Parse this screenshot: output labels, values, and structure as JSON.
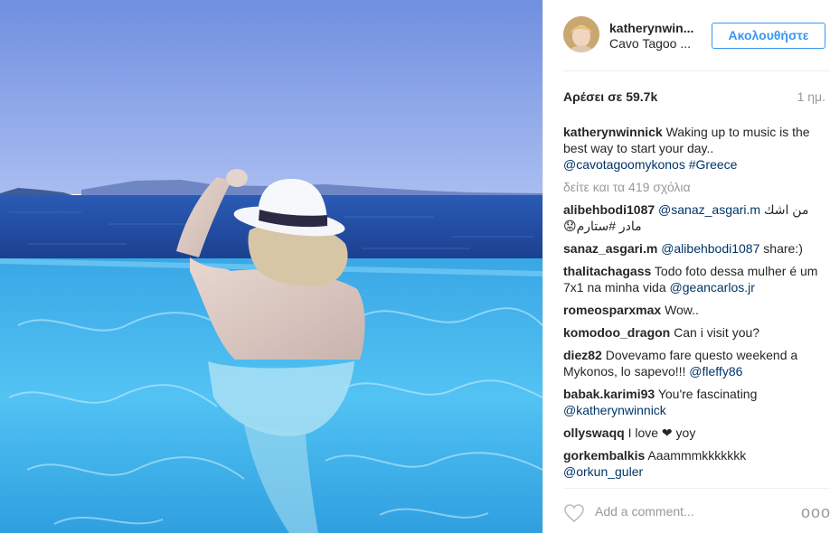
{
  "post": {
    "username": "katherynwin...",
    "location": "Cavo Tagoo ...",
    "follow_label": "Ακολουθήστε",
    "likes": "Αρέσει σε 59.7k",
    "time": "1 ημ.",
    "caption": {
      "user": "katherynwinnick",
      "text": "Waking up to music is the best way to start your day.. ",
      "mention": "@cavotagoomykonos",
      "hashtag": "#Greece"
    },
    "view_all": "δείτε και τα 419 σχόλια",
    "comments": [
      {
        "user": "alibehbodi1087",
        "mention": "@sanaz_asgari.m",
        "text": "من اشك مادر #ستارم😟"
      },
      {
        "user": "sanaz_asgari.m",
        "mention": "@alibehbodi1087",
        "text": " share:)"
      },
      {
        "user": "thalitachagass",
        "text": "Todo foto dessa mulher é um 7x1 na minha vida ",
        "mention": "@geancarlos.jr"
      },
      {
        "user": "romeosparxmax",
        "text": "Wow.."
      },
      {
        "user": "komodoo_dragon",
        "text": "Can i visit you?"
      },
      {
        "user": "diez82",
        "text": "Dovevamo fare questo weekend a Mykonos, lo sapevo!!! ",
        "mention": "@fleffy86"
      },
      {
        "user": "babak.karimi93",
        "text": "You're fascinating ",
        "mention": "@katherynwinnick"
      },
      {
        "user": "ollyswaqq",
        "text": "I love ❤ yoy"
      },
      {
        "user": "gorkembalkis",
        "text": "Aaammmkkkkkkk ",
        "mention": "@orkun_guler"
      }
    ],
    "add_comment_placeholder": "Add a comment...",
    "more_label": "ooo"
  },
  "icons": {
    "heart": "heart-outline-icon",
    "more": "more-options-icon"
  },
  "colors": {
    "accent": "#3897f0",
    "mention": "#003569",
    "muted": "#999999",
    "pool": "#3fb0e8",
    "sea": "#1f4fa3",
    "sky": "#7e9ce0"
  }
}
